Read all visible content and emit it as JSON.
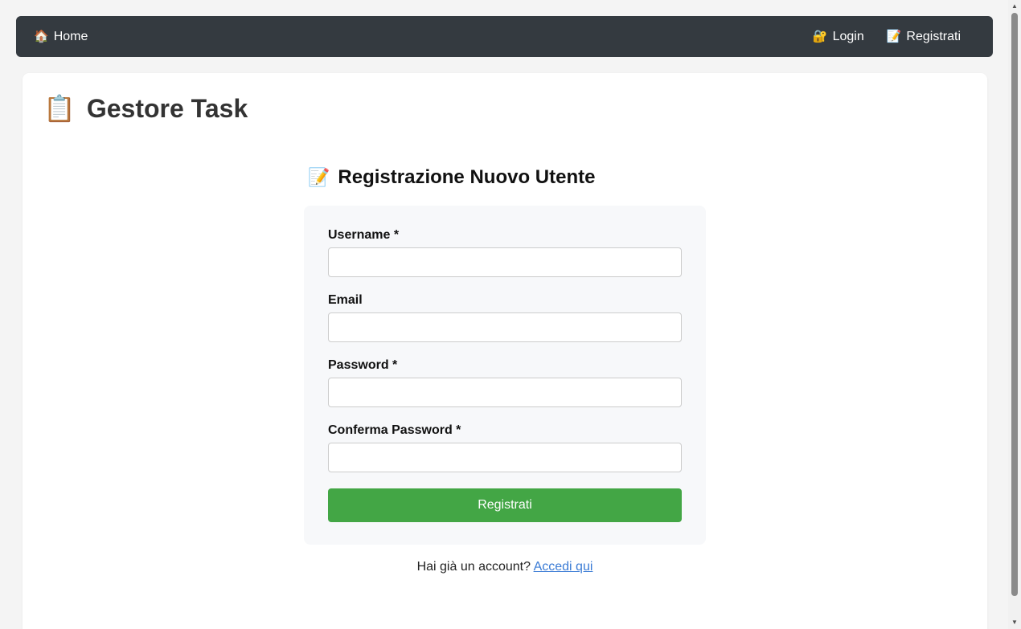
{
  "navbar": {
    "home": {
      "icon": "house-icon",
      "glyph": "🏠",
      "label": "Home"
    },
    "login": {
      "icon": "lock-key-icon",
      "glyph": "🔐",
      "label": "Login"
    },
    "register": {
      "icon": "memo-icon",
      "glyph": "📝",
      "label": "Registrati"
    },
    "background": "#343a40"
  },
  "app": {
    "title_icon": "clipboard-icon",
    "title_glyph": "📋",
    "title": "Gestore Task"
  },
  "form": {
    "heading_icon": "memo-icon",
    "heading_glyph": "📝",
    "heading": "Registrazione Nuovo Utente",
    "fields": {
      "username": {
        "label": "Username *",
        "value": "",
        "placeholder": ""
      },
      "email": {
        "label": "Email",
        "value": "",
        "placeholder": ""
      },
      "password": {
        "label": "Password *",
        "value": "",
        "placeholder": ""
      },
      "confirm_password": {
        "label": "Conferma Password *",
        "value": "",
        "placeholder": ""
      }
    },
    "submit_label": "Registrati",
    "submit_color": "#43a645"
  },
  "footer": {
    "prompt": "Hai già un account?",
    "link": "Accedi qui",
    "link_color": "#3a7bd5"
  },
  "scrollbar": {
    "up_glyph": "▲",
    "down_glyph": "▼"
  }
}
